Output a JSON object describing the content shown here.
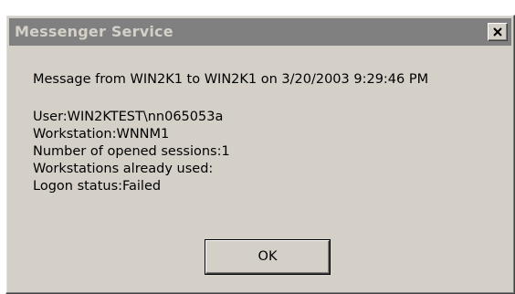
{
  "window": {
    "title": "Messenger Service",
    "close_glyph": "×",
    "close_icon": "close-icon"
  },
  "message": {
    "header": "Message from WIN2K1 to WIN2K1 on 3/20/2003 9:29:46 PM",
    "lines": [
      "User:WIN2KTEST\\nn065053a",
      "Workstation:WNNM1",
      "Number of opened sessions:1",
      "Workstations already used:",
      "Logon status:Failed"
    ]
  },
  "buttons": {
    "ok_label": "OK"
  },
  "colors": {
    "titlebar": "#808080",
    "title_text": "#d4d0c8",
    "face": "#d4d0c8"
  }
}
